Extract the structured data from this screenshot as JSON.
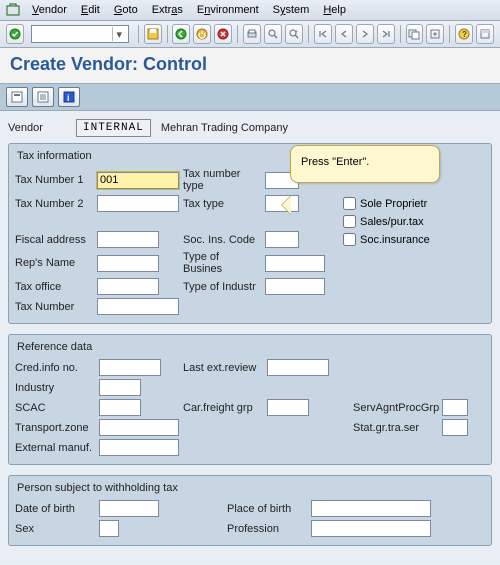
{
  "menu": {
    "vendor": "Vendor",
    "edit": "Edit",
    "goto": "Goto",
    "extras": "Extras",
    "environment": "Environment",
    "system": "System",
    "help": "Help"
  },
  "title": "Create Vendor: Control",
  "header": {
    "vendor_label": "Vendor",
    "vendor_code": "INTERNAL",
    "vendor_name": "Mehran Trading Company"
  },
  "tooltip": "Press \"Enter\".",
  "groups": {
    "tax": {
      "title": "Tax information",
      "tax_number1_label": "Tax Number 1",
      "tax_number1_value": "001",
      "tax_number_type_label": "Tax number type",
      "tax_number2_label": "Tax Number 2",
      "tax_type_label": "Tax type",
      "sole_prop_label": "Sole Proprietr",
      "sales_pur_label": "Sales/pur.tax",
      "soc_ins_label": "Soc.insurance",
      "fiscal_addr_label": "Fiscal address",
      "soc_ins_code_label": "Soc. Ins. Code",
      "reps_name_label": "Rep's Name",
      "type_business_label": "Type of Busines",
      "tax_office_label": "Tax office",
      "type_industry_label": "Type of Industr",
      "tax_number_label": "Tax Number"
    },
    "ref": {
      "title": "Reference data",
      "cred_info_label": "Cred.info no.",
      "last_ext_review_label": "Last ext.review",
      "industry_label": "Industry",
      "scac_label": "SCAC",
      "car_freight_label": "Car.freight grp",
      "serv_agnt_label": "ServAgntProcGrp",
      "transport_zone_label": "Transport.zone",
      "stat_gr_label": "Stat.gr.tra.ser",
      "external_manuf_label": "External manuf."
    },
    "with": {
      "title": "Person subject to withholding tax",
      "dob_label": "Date of birth",
      "pob_label": "Place of birth",
      "sex_label": "Sex",
      "profession_label": "Profession"
    }
  }
}
